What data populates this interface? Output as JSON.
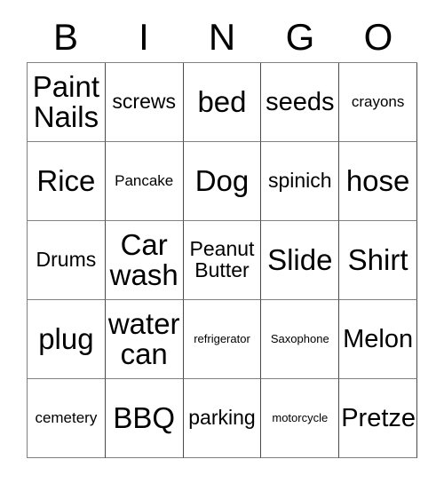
{
  "card": {
    "header_letters": [
      "B",
      "I",
      "N",
      "G",
      "O"
    ],
    "columns": 5,
    "rows": 5,
    "border_color": "#808080",
    "text_color": "#000000",
    "background_color": "#ffffff",
    "cells": [
      {
        "text": "Paint Nails",
        "size": "xl"
      },
      {
        "text": "screws",
        "size": "md"
      },
      {
        "text": "bed",
        "size": "xl"
      },
      {
        "text": "seeds",
        "size": "lg"
      },
      {
        "text": "crayons",
        "size": "sm"
      },
      {
        "text": "Rice",
        "size": "xl"
      },
      {
        "text": "Pancake",
        "size": "sm"
      },
      {
        "text": "Dog",
        "size": "xl"
      },
      {
        "text": "spinich",
        "size": "md"
      },
      {
        "text": "hose",
        "size": "xl"
      },
      {
        "text": "Drums",
        "size": "md"
      },
      {
        "text": "Car wash",
        "size": "xl"
      },
      {
        "text": "Peanut Butter",
        "size": "md"
      },
      {
        "text": "Slide",
        "size": "xl"
      },
      {
        "text": "Shirt",
        "size": "xl"
      },
      {
        "text": "plug",
        "size": "xl"
      },
      {
        "text": "water can",
        "size": "xl"
      },
      {
        "text": "refrigerator",
        "size": "xs"
      },
      {
        "text": "Saxophone",
        "size": "xs"
      },
      {
        "text": "Melon",
        "size": "lg"
      },
      {
        "text": "cemetery",
        "size": "sm"
      },
      {
        "text": "BBQ",
        "size": "xl"
      },
      {
        "text": "parking",
        "size": "md"
      },
      {
        "text": "motorcycle",
        "size": "xs"
      },
      {
        "text": "Pretzel",
        "size": "lg"
      }
    ]
  }
}
